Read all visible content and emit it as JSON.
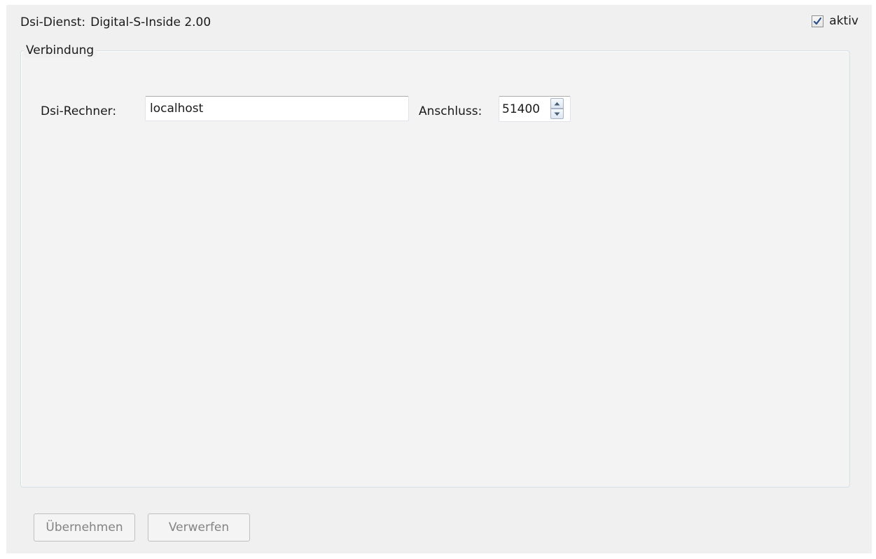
{
  "service": {
    "label": "Dsi-Dienst:",
    "name": "Digital-S-Inside 2.00"
  },
  "active": {
    "label": "aktiv",
    "checked": true
  },
  "connection": {
    "title": "Verbindung",
    "host_label": "Dsi-Rechner:",
    "host_value": "localhost",
    "port_label": "Anschluss:",
    "port_value": "51400"
  },
  "buttons": {
    "apply_label": "Übernehmen",
    "discard_label": "Verwerfen",
    "disabled": true
  },
  "icons": {
    "active_checkbox": "checkmark-icon",
    "port_up": "arrow-up-icon",
    "port_down": "arrow-down-icon"
  },
  "colors": {
    "panel_background": "#f0f0f0",
    "checkmark": "#2a4c87",
    "disabled_text": "#838383"
  }
}
